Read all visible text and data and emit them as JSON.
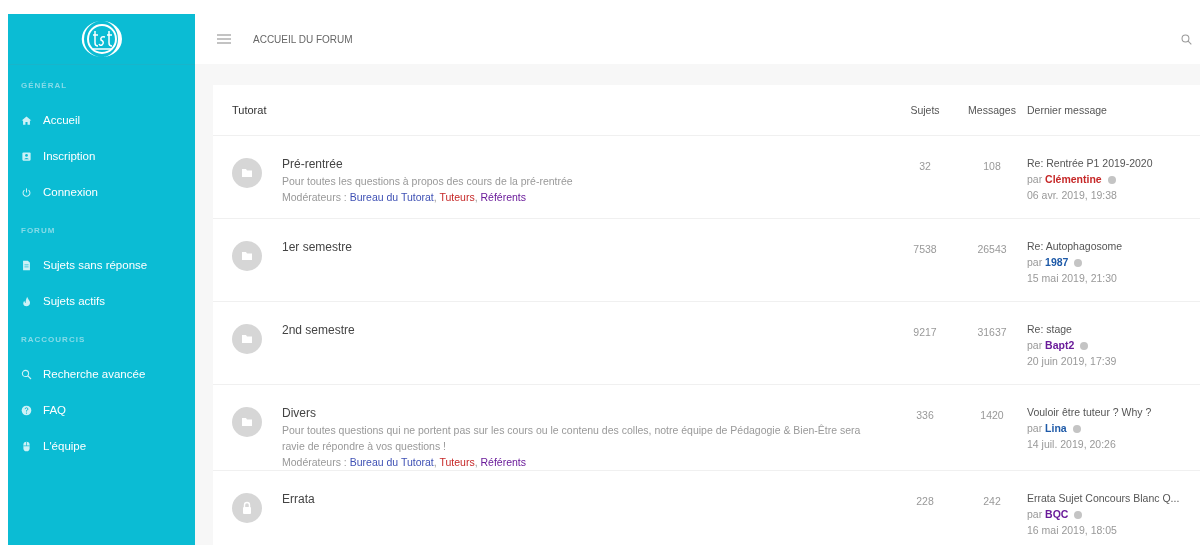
{
  "sidebar": {
    "sections": [
      {
        "label": "GÉNÉRAL",
        "items": [
          {
            "label": "Accueil"
          },
          {
            "label": "Inscription"
          },
          {
            "label": "Connexion"
          }
        ]
      },
      {
        "label": "FORUM",
        "items": [
          {
            "label": "Sujets sans réponse"
          },
          {
            "label": "Sujets actifs"
          }
        ]
      },
      {
        "label": "RACCOURCIS",
        "items": [
          {
            "label": "Recherche avancée"
          },
          {
            "label": "FAQ"
          },
          {
            "label": "L'équipe"
          }
        ]
      }
    ]
  },
  "header": {
    "title": "ACCUEIL DU FORUM"
  },
  "forum": {
    "category": "Tutorat",
    "columns": [
      "Sujets",
      "Messages",
      "Dernier message"
    ],
    "rows": [
      {
        "title": "Pré-rentrée",
        "locked": false,
        "description": "Pour toutes les questions à propos des cours de la pré-rentrée",
        "moderators_label": "Modérateurs :",
        "moderators": [
          {
            "name": "Bureau du Tutorat",
            "color": "#3f51b5",
            "separator": ","
          },
          {
            "name": "Tuteurs",
            "color": "#c62828",
            "separator": ","
          },
          {
            "name": "Référents",
            "color": "#6a1b9a"
          }
        ],
        "topics": "32",
        "posts": "108",
        "last": {
          "subject": "Re: Rentrée P1 2019-2020",
          "by": "par",
          "author": {
            "name": "Clémentine",
            "color": "#c62828"
          },
          "date": "06 avr. 2019, 19:38"
        }
      },
      {
        "title": "1er semestre",
        "locked": false,
        "topics": "7538",
        "posts": "26543",
        "last": {
          "subject": "Re: Autophagosome",
          "by": "par",
          "author": {
            "name": "1987",
            "color": "#1e5aa8"
          },
          "date": "15 mai 2019, 21:30"
        }
      },
      {
        "title": "2nd semestre",
        "locked": false,
        "topics": "9217",
        "posts": "31637",
        "last": {
          "subject": "Re: stage",
          "by": "par",
          "author": {
            "name": "Bapt2",
            "color": "#6a1b9a"
          },
          "date": "20 juin 2019, 17:39"
        }
      },
      {
        "title": "Divers",
        "locked": false,
        "description": "Pour toutes questions qui ne portent pas sur les cours ou le contenu des colles, notre équipe de Pédagogie & Bien-Être sera ravie de répondre à vos questions !",
        "moderators_label": "Modérateurs :",
        "moderators": [
          {
            "name": "Bureau du Tutorat",
            "color": "#3f51b5",
            "separator": ","
          },
          {
            "name": "Tuteurs",
            "color": "#c62828",
            "separator": ","
          },
          {
            "name": "Référents",
            "color": "#6a1b9a"
          }
        ],
        "topics": "336",
        "posts": "1420",
        "last": {
          "subject": "Vouloir être tuteur ? Why ?",
          "by": "par",
          "author": {
            "name": "Lina",
            "color": "#1e5aa8"
          },
          "date": "14 juil. 2019, 20:26"
        }
      },
      {
        "title": "Errata",
        "locked": true,
        "topics": "228",
        "posts": "242",
        "last": {
          "subject": "Errata Sujet Concours Blanc Q...",
          "by": "par",
          "author": {
            "name": "BQC",
            "color": "#6a1b9a"
          },
          "date": "16 mai 2019, 18:05"
        }
      }
    ]
  }
}
